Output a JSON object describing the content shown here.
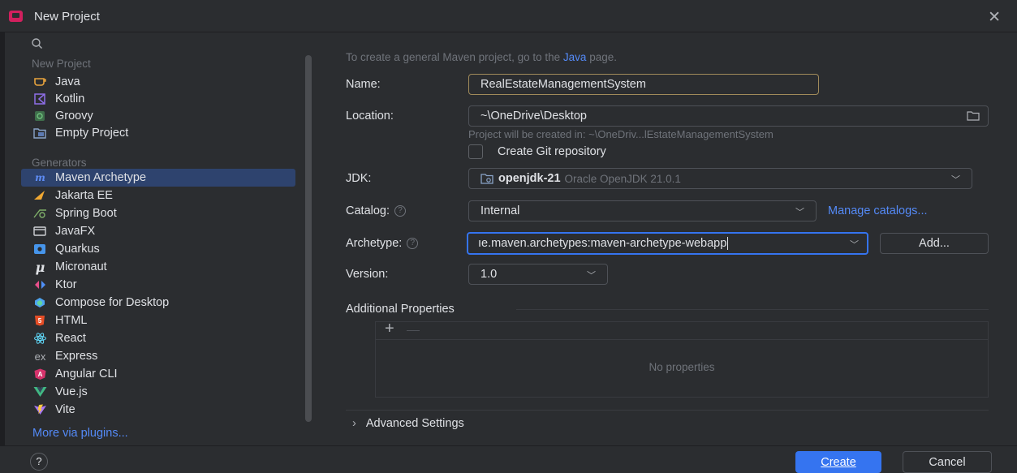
{
  "window": {
    "title": "New Project"
  },
  "sidebar": {
    "section_new": "New Project",
    "items_new": [
      {
        "label": "Java",
        "icon": "java-icon"
      },
      {
        "label": "Kotlin",
        "icon": "kotlin-icon"
      },
      {
        "label": "Groovy",
        "icon": "groovy-icon"
      },
      {
        "label": "Empty Project",
        "icon": "empty-project-icon"
      }
    ],
    "section_generators": "Generators",
    "items_generators": [
      {
        "label": "Maven Archetype",
        "icon": "maven-icon",
        "selected": true
      },
      {
        "label": "Jakarta EE",
        "icon": "jakarta-icon"
      },
      {
        "label": "Spring Boot",
        "icon": "spring-icon"
      },
      {
        "label": "JavaFX",
        "icon": "javafx-icon"
      },
      {
        "label": "Quarkus",
        "icon": "quarkus-icon"
      },
      {
        "label": "Micronaut",
        "icon": "micronaut-icon"
      },
      {
        "label": "Ktor",
        "icon": "ktor-icon"
      },
      {
        "label": "Compose for Desktop",
        "icon": "compose-icon"
      },
      {
        "label": "HTML",
        "icon": "html-icon"
      },
      {
        "label": "React",
        "icon": "react-icon"
      },
      {
        "label": "Express",
        "icon": "express-icon"
      },
      {
        "label": "Angular CLI",
        "icon": "angular-icon"
      },
      {
        "label": "Vue.js",
        "icon": "vue-icon"
      },
      {
        "label": "Vite",
        "icon": "vite-icon"
      }
    ],
    "more_link": "More via plugins..."
  },
  "main": {
    "hint_prefix": "To create a general Maven project, go to the ",
    "hint_link": "Java",
    "hint_suffix": " page.",
    "name_label": "Name:",
    "name_value": "RealEstateManagementSystem",
    "location_label": "Location:",
    "location_value": "~\\OneDrive\\Desktop",
    "location_note": "Project will be created in: ~\\OneDriv...lEstateManagementSystem",
    "git_label": "Create Git repository",
    "jdk_label": "JDK:",
    "jdk_name": "openjdk-21",
    "jdk_detail": "Oracle OpenJDK 21.0.1",
    "catalog_label": "Catalog:",
    "catalog_value": "Internal",
    "manage_catalogs": "Manage catalogs...",
    "archetype_label": "Archetype:",
    "archetype_value": "ıe.maven.archetypes:maven-archetype-webapp",
    "add_button": "Add...",
    "version_label": "Version:",
    "version_value": "1.0",
    "additional_props": "Additional Properties",
    "no_properties": "No properties",
    "advanced": "Advanced Settings"
  },
  "footer": {
    "help": "?",
    "create": "Create",
    "cancel": "Cancel"
  },
  "colors": {
    "accent": "#3574f0",
    "selection": "#2e436e",
    "link": "#548af7",
    "background": "#2b2d30"
  }
}
